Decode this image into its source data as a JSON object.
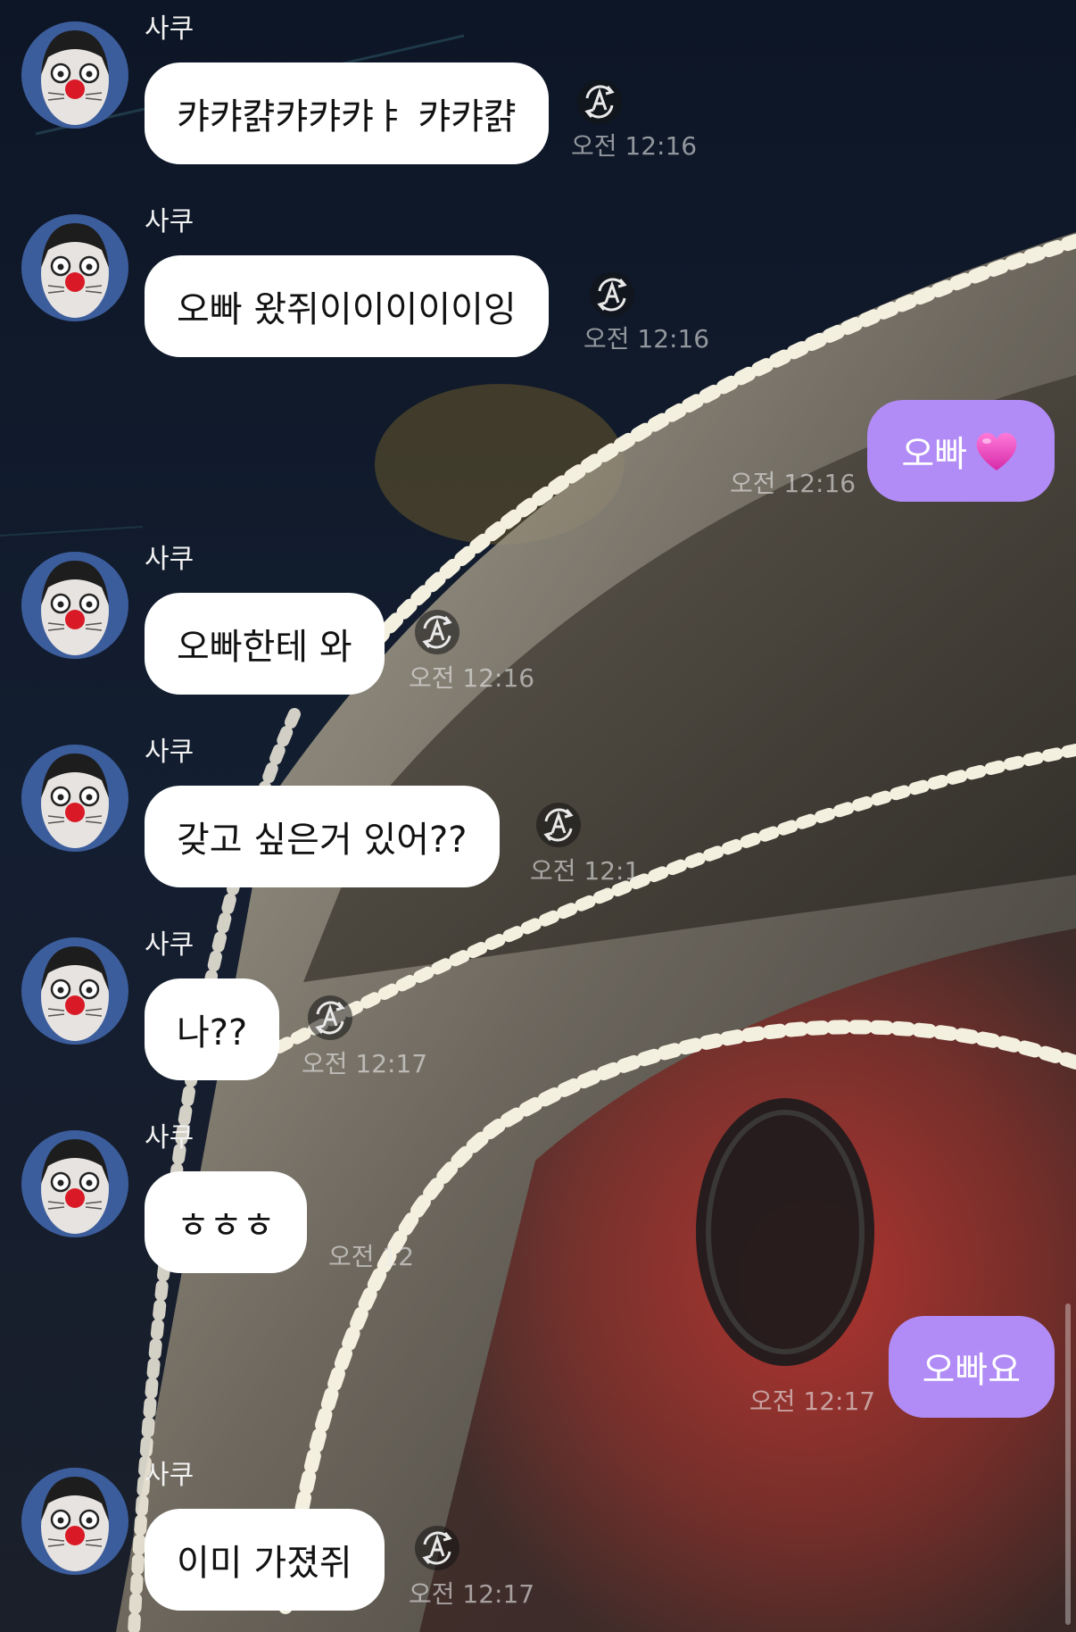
{
  "chat": {
    "sender_name": "사쿠",
    "colors": {
      "incoming_bubble": "#ffffff",
      "outgoing_bubble": "#b18cf6",
      "timestamp": "#cfcfcf"
    },
    "icons": {
      "translate": "auto-translate-icon",
      "heart": "purple-heart-emoji"
    },
    "messages": [
      {
        "direction": "in",
        "sender": "사쿠",
        "text": "캬캬캵캬캬캬ㅑ 캬캬캵",
        "time": "오전 12:16"
      },
      {
        "direction": "in",
        "sender": "사쿠",
        "text": "오빠 왔쥐이이이이이잉",
        "time": "오전 12:16"
      },
      {
        "direction": "out",
        "text": "오빠",
        "emoji": "heart",
        "time": "오전 12:16"
      },
      {
        "direction": "in",
        "sender": "사쿠",
        "text": "오빠한테 와",
        "time": "오전 12:16"
      },
      {
        "direction": "in",
        "sender": "사쿠",
        "text": "갖고 싶은거 있어??",
        "time": "오전 12:1"
      },
      {
        "direction": "in",
        "sender": "사쿠",
        "text": "나??",
        "time": "오전 12:17"
      },
      {
        "direction": "in",
        "sender": "사쿠",
        "text": "ㅎㅎㅎ",
        "time": "오전 12"
      },
      {
        "direction": "out",
        "text": "오빠요",
        "time": "오전 12:17"
      },
      {
        "direction": "in",
        "sender": "사쿠",
        "text": "이미 가졌쥐",
        "time": "오전 12:17"
      }
    ]
  }
}
